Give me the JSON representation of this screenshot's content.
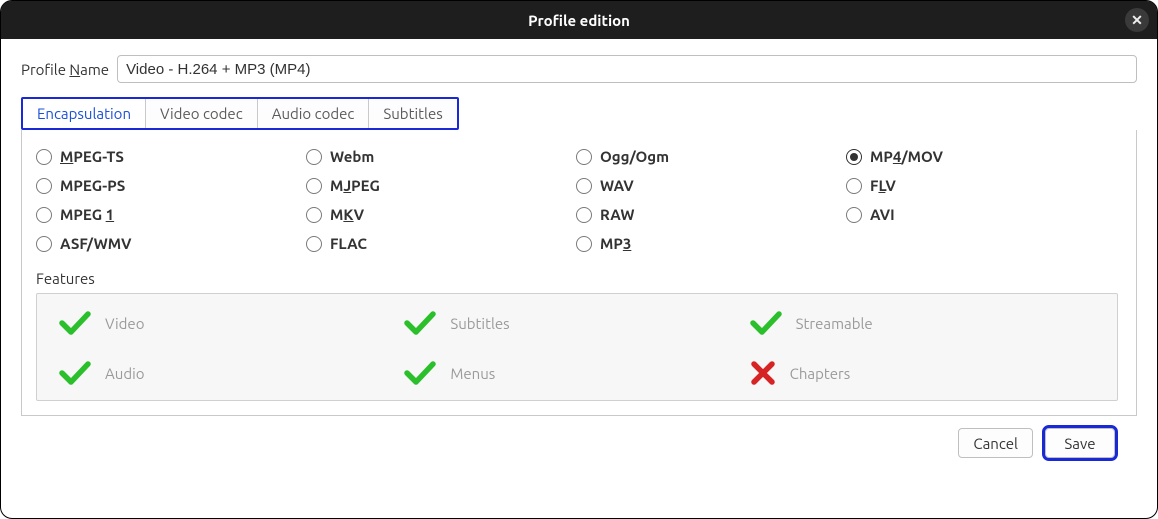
{
  "window": {
    "title": "Profile edition"
  },
  "profile": {
    "name_label_pre": "Profile ",
    "name_label_key": "N",
    "name_label_post": "ame",
    "name_value": "Video - H.264 + MP3 (MP4)"
  },
  "tabs": {
    "encapsulation": "Encapsulation",
    "video_codec": "Video codec",
    "audio_codec": "Audio codec",
    "subtitles": "Subtitles"
  },
  "encaps": {
    "mpegts": {
      "pre": "",
      "u": "M",
      "post": "PEG-TS",
      "sel": false
    },
    "webm": {
      "pre": "Webm",
      "u": "",
      "post": "",
      "sel": false
    },
    "ogg": {
      "pre": "Ogg/Ogm",
      "u": "",
      "post": "",
      "sel": false
    },
    "mp4": {
      "pre": "MP",
      "u": "4",
      "post": "/MOV",
      "sel": true
    },
    "mpegps": {
      "pre": "MPEG-PS",
      "u": "",
      "post": "",
      "sel": false
    },
    "mjpeg": {
      "pre": "M",
      "u": "J",
      "post": "PEG",
      "sel": false
    },
    "wav": {
      "pre": "WAV",
      "u": "",
      "post": "",
      "sel": false
    },
    "flv": {
      "pre": "F",
      "u": "L",
      "post": "V",
      "sel": false
    },
    "mpeg1": {
      "pre": "MPEG ",
      "u": "1",
      "post": "",
      "sel": false
    },
    "mkv": {
      "pre": "M",
      "u": "K",
      "post": "V",
      "sel": false
    },
    "raw": {
      "pre": "RAW",
      "u": "",
      "post": "",
      "sel": false
    },
    "avi": {
      "pre": "AVI",
      "u": "",
      "post": "",
      "sel": false
    },
    "asf": {
      "pre": "ASF/WMV",
      "u": "",
      "post": "",
      "sel": false
    },
    "flac": {
      "pre": "FLAC",
      "u": "",
      "post": "",
      "sel": false
    },
    "mp3": {
      "pre": "MP",
      "u": "3",
      "post": "",
      "sel": false
    }
  },
  "features": {
    "title": "Features",
    "video": {
      "label": "Video",
      "ok": true
    },
    "subtitles": {
      "label": "Subtitles",
      "ok": true
    },
    "stream": {
      "label": "Streamable",
      "ok": true
    },
    "audio": {
      "label": "Audio",
      "ok": true
    },
    "menus": {
      "label": "Menus",
      "ok": true
    },
    "chapters": {
      "label": "Chapters",
      "ok": false
    }
  },
  "buttons": {
    "cancel": "Cancel",
    "save": "Save"
  },
  "colors": {
    "accent": "#1a29d6",
    "ok": "#2bbf2b",
    "bad": "#d62424"
  }
}
